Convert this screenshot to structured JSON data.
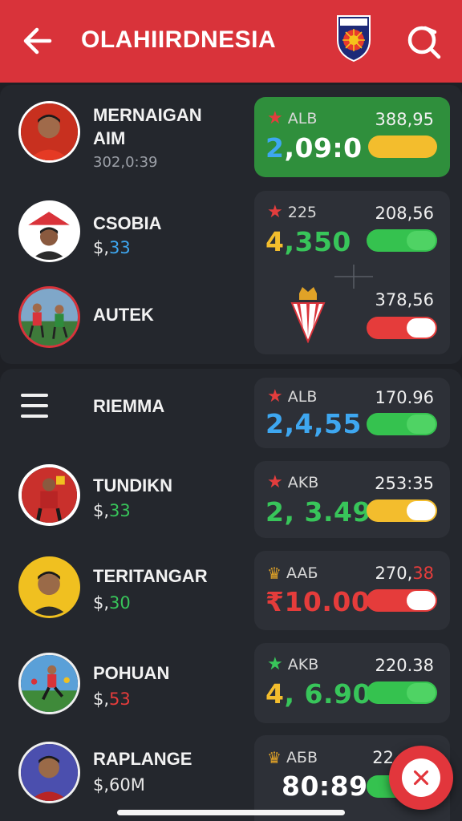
{
  "header": {
    "title": "OLAHIIRDNESIA"
  },
  "rows": [
    {
      "name_line1": "MERNAIGAN",
      "name_line2": "AIM",
      "sub": "302,0:39"
    },
    {
      "name": "CSOBIA",
      "sub_prefix": "$,",
      "sub_value": "33"
    },
    {
      "name": "AUTEK"
    },
    {
      "name": "RIEMMA"
    },
    {
      "name": "TUNDIKN",
      "sub_prefix": "$,",
      "sub_value": "33"
    },
    {
      "name": "TERITANGAR",
      "sub_prefix": "$,",
      "sub_value": "30"
    },
    {
      "name": "POHUAN",
      "sub_prefix": "$,",
      "sub_value": "53"
    },
    {
      "name": "RAPLANGE",
      "sub": "$,60M"
    }
  ],
  "cards": [
    {
      "tag": "ALB",
      "num": "388,95",
      "big_a": "2",
      "big_b": ",09:0",
      "toggle": "yellow"
    },
    {
      "tag": "225",
      "num": "208,56",
      "big_a": "4",
      "big_b": ",350",
      "toggle": "green"
    },
    {
      "num": "378,56",
      "toggle": "red"
    },
    {
      "tag": "ALB",
      "num": "170.96",
      "big": "2,4,55",
      "toggle": "green"
    },
    {
      "tag": "AKB",
      "num": "253:35",
      "big_a": "2",
      "big_b": ", 3.49",
      "toggle": "yellow"
    },
    {
      "tag": "AAБ",
      "num_a": "270,",
      "num_b": "38",
      "big": "₹10.00",
      "toggle": "red"
    },
    {
      "tag": "AKB",
      "num": "220.38",
      "big_a": "4",
      "big_b": ", 6.90",
      "toggle": "green"
    },
    {
      "tag": "AБB",
      "num": "22",
      "big": "80:89",
      "toggle": "green"
    }
  ],
  "colors": {
    "header_red": "#d9333a",
    "card_green": "#2f8f3c",
    "accent_blue": "#3ea7f0",
    "accent_green": "#38c55a",
    "accent_yellow": "#f3bd2d",
    "accent_red": "#e53c3b"
  },
  "icons": [
    "back-arrow-icon",
    "team-crest-icon",
    "search-icon",
    "menu-icon",
    "star-icon",
    "crown-icon",
    "close-icon"
  ]
}
